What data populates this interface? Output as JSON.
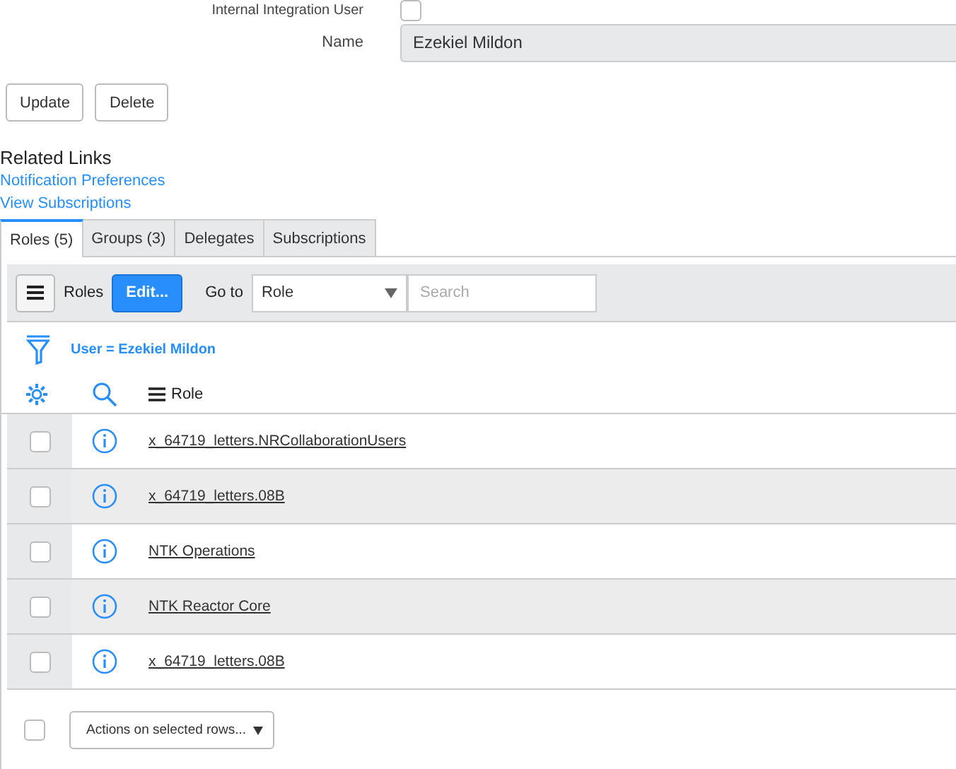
{
  "form": {
    "integration_user": {
      "label": "Internal Integration User",
      "checked": false
    },
    "name": {
      "label": "Name",
      "value": "Ezekiel Mildon"
    },
    "buttons": [
      "Update",
      "Delete"
    ]
  },
  "related_links": {
    "title": "Related Links",
    "links": [
      "Notification Preferences",
      "View Subscriptions"
    ]
  },
  "tabs": [
    {
      "label": "Roles (5)",
      "selected": true
    },
    {
      "label": "Groups (3)",
      "selected": false
    },
    {
      "label": "Delegates",
      "selected": false
    },
    {
      "label": "Subscriptions",
      "selected": false
    }
  ],
  "list": {
    "title": "Roles",
    "edit_button": "Edit...",
    "goto_label": "Go to",
    "goto_field": "Role",
    "search": {
      "placeholder": "Search"
    },
    "filter": "User = Ezekiel Mildon",
    "column": "Role",
    "rows": [
      {
        "role": "x_64719_letters.NRCollaborationUsers",
        "checked": false
      },
      {
        "role": "x_64719_letters.08B",
        "checked": false
      },
      {
        "role": "NTK Operations",
        "checked": false
      },
      {
        "role": "NTK Reactor Core",
        "checked": false
      },
      {
        "role": "x_64719_letters.08B",
        "checked": false
      }
    ],
    "select_all_checked": false,
    "actions": "Actions on selected rows..."
  }
}
